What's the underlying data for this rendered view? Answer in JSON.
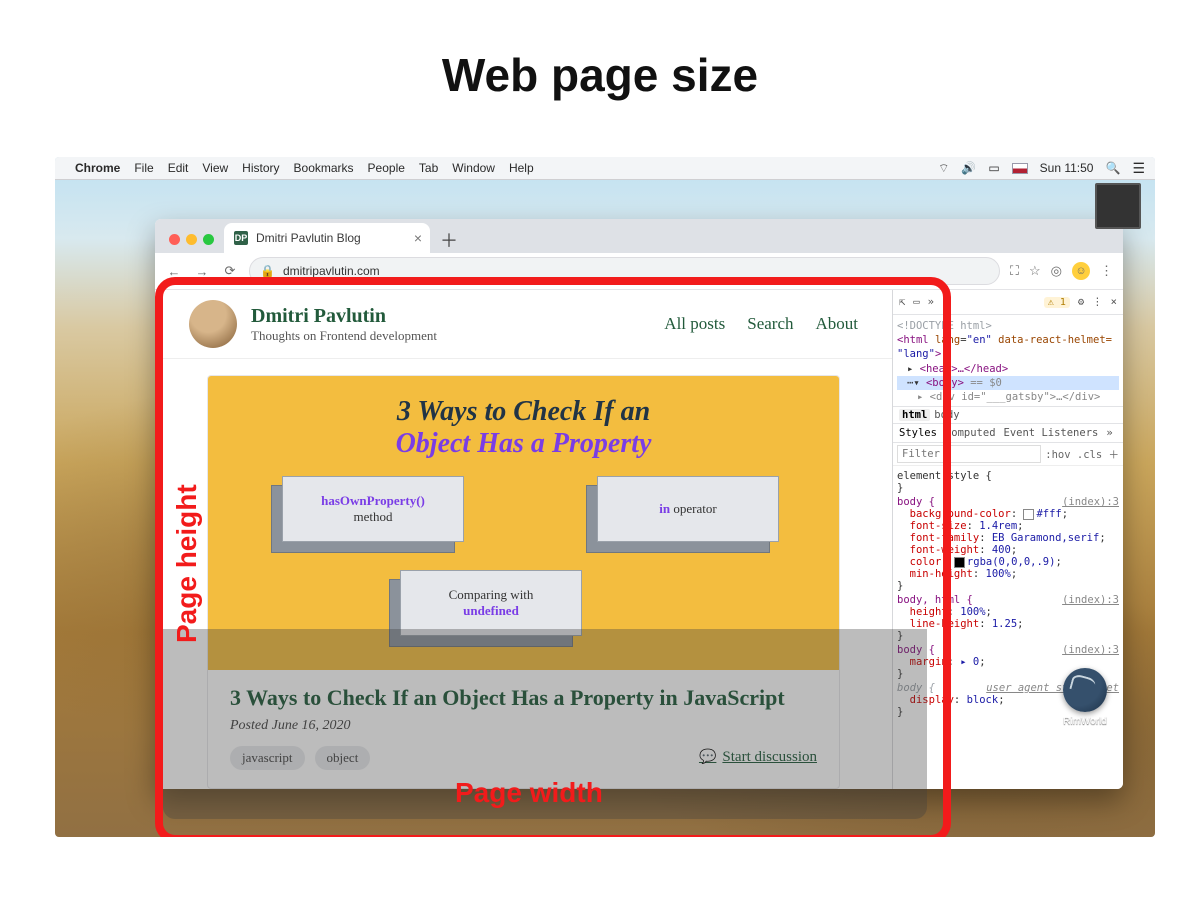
{
  "title": "Web page size",
  "menubar": {
    "app": "Chrome",
    "items": [
      "File",
      "Edit",
      "View",
      "History",
      "Bookmarks",
      "People",
      "Tab",
      "Window",
      "Help"
    ],
    "clock": "Sun 11:50",
    "icons": {
      "wifi": "wifi-icon",
      "volume": "volume-icon",
      "battery": "battery-icon",
      "search": "search-icon",
      "control": "control-center-icon"
    }
  },
  "dock": {
    "rimworld_label": "RimWorld"
  },
  "chrome": {
    "tab_title": "Dmitri Pavlutin Blog",
    "favicon_text": "DP",
    "url": "dmitripavlutin.com",
    "nav": {
      "back": "←",
      "forward": "→",
      "reload": "⟳"
    },
    "toolbar_right": {
      "screen": "⛶",
      "star": "☆",
      "ext": "◎",
      "menu": "⋮"
    }
  },
  "site": {
    "name": "Dmitri Pavlutin",
    "tagline": "Thoughts on Frontend development",
    "nav": {
      "all_posts": "All posts",
      "search": "Search",
      "about": "About"
    }
  },
  "hero": {
    "line1": "3 Ways to Check If an",
    "line2": "Object Has a Property",
    "tiles": {
      "a": {
        "top": "hasOwnProperty()",
        "bottom": "method"
      },
      "b": {
        "top": "in",
        "top2": " operator"
      },
      "c": {
        "top": "Comparing with",
        "bottom": "undefined"
      }
    }
  },
  "article": {
    "title": "3 Ways to Check If an Object Has a Property in JavaScript",
    "posted_prefix": "Posted ",
    "posted_date": "June 16, 2020",
    "tags": [
      "javascript",
      "object"
    ],
    "discussion": "Start discussion"
  },
  "devtools": {
    "warn_count": "1",
    "elements": {
      "doctype": "<!DOCTYPE html>",
      "html_open": "<html ",
      "html_lang_attr": "lang",
      "html_lang_val": "\"en\"",
      "html_helmet_attr": " data-react-helmet=",
      "html_helmet_val": "\"lang\"",
      "head": "<head>…</head>",
      "body_open": "<body>",
      "body_dim": " == $0",
      "div_line": "<div id=\"___gatsby\">…</div>"
    },
    "crumbs": {
      "html": "html",
      "body": "body"
    },
    "tabs": {
      "styles": "Styles",
      "computed": "Computed",
      "events": "Event Listeners"
    },
    "filter_placeholder": "Filter",
    "filter_right": ":hov .cls ＋",
    "element_style": "element.style {",
    "rules": [
      {
        "selector": "body",
        "source": "(index):3",
        "decls": [
          {
            "prop": "background-color",
            "val": "#fff",
            "swatch": "#ffffff"
          },
          {
            "prop": "font-size",
            "val": "1.4rem"
          },
          {
            "prop": "font-family",
            "val": "EB Garamond,serif"
          },
          {
            "prop": "font-weight",
            "val": "400"
          },
          {
            "prop": "color",
            "val": "rgba(0,0,0,.9)",
            "swatch": "#000000"
          },
          {
            "prop": "min-height",
            "val": "100%"
          }
        ]
      },
      {
        "selector": "body, html",
        "source": "(index):3",
        "decls": [
          {
            "prop": "height",
            "val": "100%"
          },
          {
            "prop": "line-height",
            "val": "1.25"
          }
        ]
      },
      {
        "selector": "body",
        "source": "(index):3",
        "decls": [
          {
            "prop": "margin",
            "val": "▸ 0"
          }
        ]
      },
      {
        "selector": "body",
        "source": "user agent stylesheet",
        "ua": true,
        "decls": [
          {
            "prop": "display",
            "val": "block"
          }
        ]
      }
    ]
  },
  "annotations": {
    "width": "Page width",
    "height": "Page height"
  }
}
